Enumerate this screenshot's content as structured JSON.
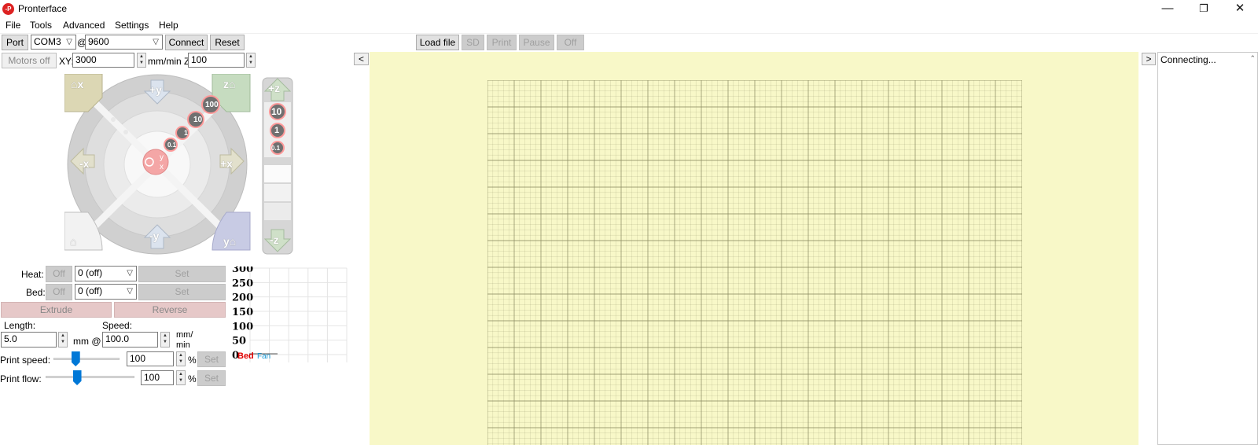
{
  "window": {
    "title": "Pronterface",
    "app_icon_text": "-P",
    "minimize": "—",
    "restore": "❐",
    "close": "✕"
  },
  "menu": [
    "File",
    "Tools",
    "Advanced",
    "Settings",
    "Help"
  ],
  "toolbar": {
    "port_label": "Port",
    "port_value": "COM3",
    "at": "@",
    "baud_value": "9600",
    "connect": "Connect",
    "reset": "Reset",
    "load_file": "Load file",
    "sd": "SD",
    "print": "Print",
    "pause": "Pause",
    "off": "Off"
  },
  "motion": {
    "motors_off": "Motors off",
    "xy_label": "XY:",
    "xy_value": "3000",
    "unit_z": "mm/min Z:",
    "z_value": "100"
  },
  "jog": {
    "plus_y": "+y",
    "minus_y": "-y",
    "plus_x": "+x",
    "minus_x": "-x",
    "home_x": "x",
    "home_y": "y",
    "home_z": "z",
    "steps": [
      "100",
      "10",
      "1",
      "0.1"
    ],
    "center_y": "y",
    "center_x": "x",
    "plus_z": "+z",
    "minus_z": "-z",
    "z_steps": [
      "10",
      "1",
      "0.1"
    ]
  },
  "temps": {
    "heat_label": "Heat:",
    "bed_label": "Bed:",
    "off": "Off",
    "heat_value": "0 (off)",
    "bed_value": "0 (off)",
    "set": "Set",
    "extrude": "Extrude",
    "reverse": "Reverse",
    "length_label": "Length:",
    "speed_label": "Speed:",
    "length_value": "5.0",
    "mm_at": "mm @",
    "speed_value": "100.0",
    "speed_unit_1": "mm/",
    "speed_unit_2": "min",
    "print_speed_label": "Print speed:",
    "print_speed_value": "100",
    "print_speed_level": 0.33,
    "print_flow_label": "Print flow:",
    "print_flow_value": "100",
    "print_flow_level": 0.35,
    "percent": "%"
  },
  "graph": {
    "ticks": [
      "300",
      "250",
      "200",
      "150",
      "100",
      "50",
      "0"
    ],
    "bed_label": "Bed",
    "fan_label": "Fan",
    "bed_color": "#e00000",
    "fan_color": "#1a9ad6"
  },
  "preview": {
    "collapse_left": "<",
    "collapse_right": ">",
    "bg_color": "#f8f8c8",
    "grid_color": "#8a8a60"
  },
  "log": {
    "text": "Connecting..."
  }
}
